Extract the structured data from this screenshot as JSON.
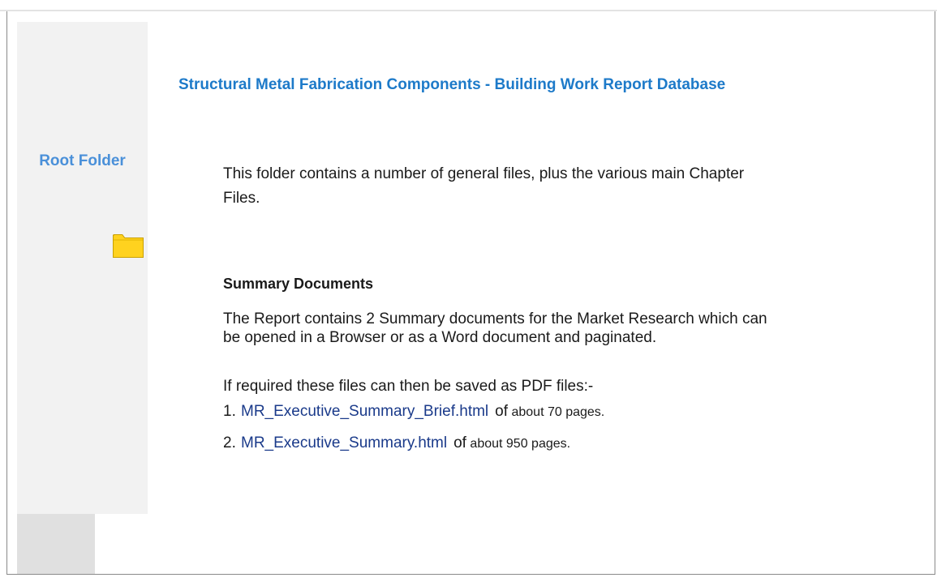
{
  "sidebar": {
    "root_folder_label": "Root Folder",
    "folder_icon": "folder-icon"
  },
  "header": {
    "title": "Structural Metal Fabrication Components - Building Work Report Database"
  },
  "main": {
    "intro": "This folder contains a number of general files, plus the various main Chapter Files.",
    "section_heading": "Summary Documents",
    "summary_text": "The Report contains 2 Summary documents for the Market Research which can be opened in a Browser or as a Word document and paginated.",
    "pdf_text": "If required these files can then be saved as PDF files:-",
    "documents": [
      {
        "number": "1.",
        "link": "MR_Executive_Summary_Brief.html",
        "of": "of",
        "pages": "about 70 pages."
      },
      {
        "number": "2.",
        "link": "MR_Executive_Summary.html",
        "of": "of",
        "pages": "about 950 pages."
      }
    ]
  },
  "colors": {
    "title": "#1d7ac9",
    "root_folder": "#4a90d9",
    "link": "#1a3a8a",
    "folder_fill": "#ffd21f",
    "sidebar_bg": "#f2f2f2"
  }
}
